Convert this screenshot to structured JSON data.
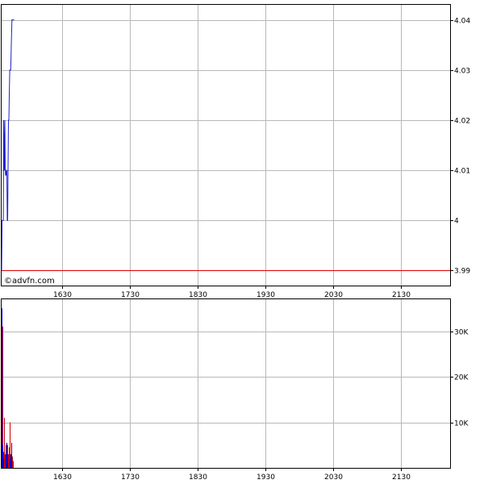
{
  "watermark": "©advfn.com",
  "colors": {
    "price_line": "#1f1fcf",
    "reference_line": "#dd0000",
    "grid": "#b8b8b8",
    "frame": "#000000",
    "volume_up": "#0000cc",
    "volume_down": "#cc0000"
  },
  "chart_data": [
    {
      "type": "line",
      "title": "",
      "xlabel": "",
      "ylabel": "",
      "x_ticks": [
        "1630",
        "1730",
        "1830",
        "1930",
        "2030",
        "2130"
      ],
      "x_range": [
        1541,
        2203
      ],
      "ylim": [
        3.987,
        4.043
      ],
      "y_ticks": [
        "4.04",
        "4.03",
        "4.02",
        "4.01",
        "4",
        "3.99"
      ],
      "y_tick_values": [
        4.04,
        4.03,
        4.02,
        4.01,
        4.0,
        3.99
      ],
      "grid": true,
      "reference_line": {
        "value": 3.99
      },
      "series": [
        {
          "x": [
            1541.0,
            1541.7,
            1542.3,
            1542.9,
            1543.5,
            1544.1,
            1545.0,
            1545.8,
            1546.3,
            1546.8,
            1547.4,
            1548.0,
            1548.7,
            1549.3,
            1549.9,
            1550.5,
            1551.1,
            1551.7,
            1552.3,
            1553.0,
            1553.8,
            1554.5,
            1555.3,
            1556.2,
            1557.0,
            1557.8,
            1558.5,
            1559.4
          ],
          "y": [
            3.99,
            4.0,
            4.0,
            4.0,
            4.0,
            4.02,
            4.01,
            4.02,
            4.01,
            4.009,
            4.009,
            4.01,
            4.01,
            4.0,
            4.0,
            4.01,
            4.02,
            4.02,
            4.025,
            4.03,
            4.03,
            4.03,
            4.035,
            4.04,
            4.04,
            4.04,
            4.04,
            4.04
          ]
        }
      ]
    },
    {
      "type": "bar",
      "title": "",
      "xlabel": "",
      "ylabel": "",
      "x_ticks": [
        "1630",
        "1730",
        "1830",
        "1930",
        "2030",
        "2130"
      ],
      "x_range": [
        1541,
        2203
      ],
      "ylim": [
        0,
        37000
      ],
      "y_ticks": [
        "30K",
        "20K",
        "10K"
      ],
      "y_tick_values": [
        30000,
        20000,
        10000
      ],
      "grid": true,
      "series": [
        {
          "x": [
            1541.5,
            1542.0,
            1542.5,
            1543.0,
            1543.5,
            1544.0,
            1544.5,
            1545.0,
            1545.5,
            1546.0,
            1546.5,
            1547.0,
            1547.5,
            1548.0,
            1548.5,
            1549.0,
            1549.5,
            1550.0,
            1550.5,
            1551.0,
            1551.5,
            1552.0,
            1552.5,
            1553.0,
            1553.5,
            1554.0,
            1554.5,
            1555.0,
            1555.5,
            1556.0,
            1556.5,
            1557.0,
            1557.5,
            1558.0
          ],
          "values": [
            35000,
            31000,
            5000,
            3500,
            2000,
            5000,
            4000,
            11000,
            2500,
            3000,
            1500,
            5000,
            3500,
            2000,
            5500,
            5000,
            3000,
            2500,
            1500,
            3000,
            2000,
            4500,
            3000,
            10000,
            2000,
            2500,
            3000,
            1500,
            5500,
            1500,
            2000,
            2500,
            1000,
            1500
          ],
          "colors": [
            "volume_up",
            "volume_down",
            "volume_up",
            "volume_down",
            "volume_up",
            "volume_down",
            "volume_up",
            "volume_down",
            "volume_up",
            "volume_down",
            "volume_up",
            "volume_down",
            "volume_up",
            "volume_down",
            "volume_up",
            "volume_down",
            "volume_up",
            "volume_down",
            "volume_up",
            "volume_down",
            "volume_up",
            "volume_down",
            "volume_up",
            "volume_down",
            "volume_up",
            "volume_down",
            "volume_up",
            "volume_down",
            "volume_up",
            "volume_down",
            "volume_up",
            "volume_down",
            "volume_up",
            "volume_down"
          ]
        }
      ]
    }
  ]
}
